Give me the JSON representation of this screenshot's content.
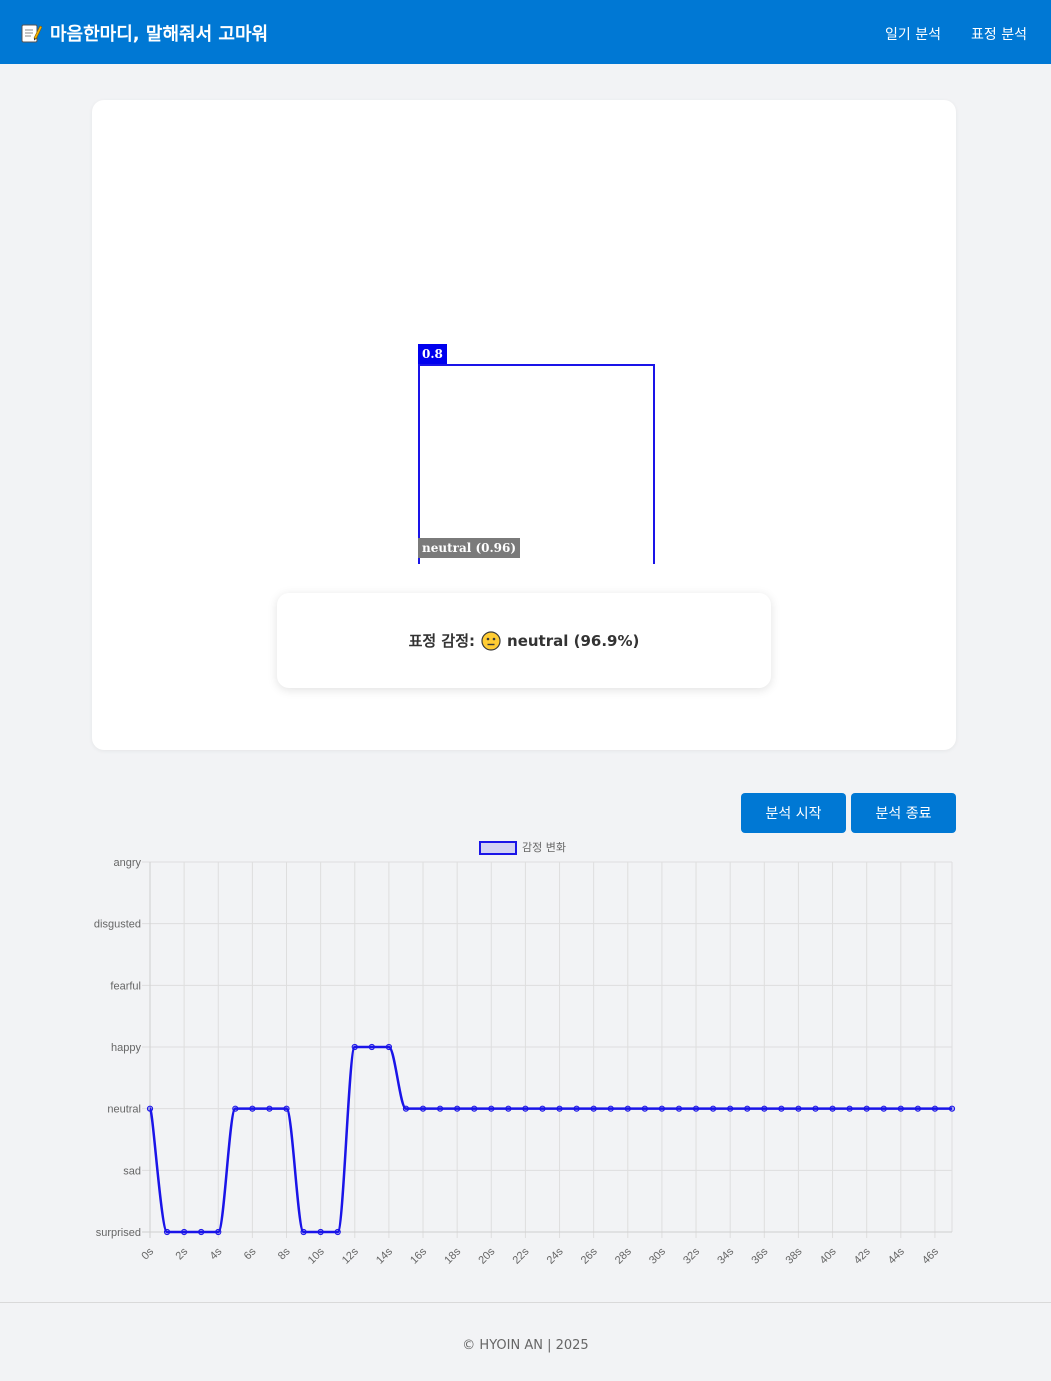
{
  "header": {
    "title": "마음한마디, 말해줘서 고마워",
    "icon": "memo-icon",
    "nav": [
      {
        "label": "일기 분석"
      },
      {
        "label": "표정 분석"
      }
    ],
    "bg_color": "#0078d4"
  },
  "detection": {
    "score_label": "0.8",
    "expression_label": "neutral (0.96)"
  },
  "result": {
    "prefix": "표정 감정:",
    "emoji": "neutral-face-emoji",
    "value": "neutral (96.9%)"
  },
  "buttons": {
    "start": "분석 시작",
    "stop": "분석 종료"
  },
  "chart_data": {
    "type": "line",
    "legend": "감정 변화",
    "legend_position": "top",
    "grid": true,
    "categories_y": [
      "surprised",
      "sad",
      "neutral",
      "happy",
      "fearful",
      "disgusted",
      "angry"
    ],
    "x_tick_labels": [
      "0s",
      "2s",
      "4s",
      "6s",
      "8s",
      "10s",
      "12s",
      "14s",
      "16s",
      "18s",
      "20s",
      "22s",
      "24s",
      "26s",
      "28s",
      "30s",
      "32s",
      "34s",
      "36s",
      "38s",
      "40s",
      "42s",
      "44s",
      "46s"
    ],
    "x": [
      0,
      1,
      2,
      3,
      4,
      5,
      6,
      7,
      8,
      9,
      10,
      11,
      12,
      13,
      14,
      15,
      16,
      17,
      18,
      19,
      20,
      21,
      22,
      23,
      24,
      25,
      26,
      27,
      28,
      29,
      30,
      31,
      32,
      33,
      34,
      35,
      36,
      37,
      38,
      39,
      40,
      41,
      42,
      43,
      44,
      45,
      46,
      47
    ],
    "series": [
      {
        "values": [
          "neutral",
          "surprised",
          "surprised",
          "surprised",
          "surprised",
          "neutral",
          "neutral",
          "neutral",
          "neutral",
          "surprised",
          "surprised",
          "surprised",
          "happy",
          "happy",
          "happy",
          "neutral",
          "neutral",
          "neutral",
          "neutral",
          "neutral",
          "neutral",
          "neutral",
          "neutral",
          "neutral",
          "neutral",
          "neutral",
          "neutral",
          "neutral",
          "neutral",
          "neutral",
          "neutral",
          "neutral",
          "neutral",
          "neutral",
          "neutral",
          "neutral",
          "neutral",
          "neutral",
          "neutral",
          "neutral",
          "neutral",
          "neutral",
          "neutral",
          "neutral",
          "neutral",
          "neutral",
          "neutral",
          "neutral"
        ],
        "color": "#1a14e8"
      }
    ]
  },
  "footer": {
    "text": "© HYOIN AN | 2025"
  }
}
